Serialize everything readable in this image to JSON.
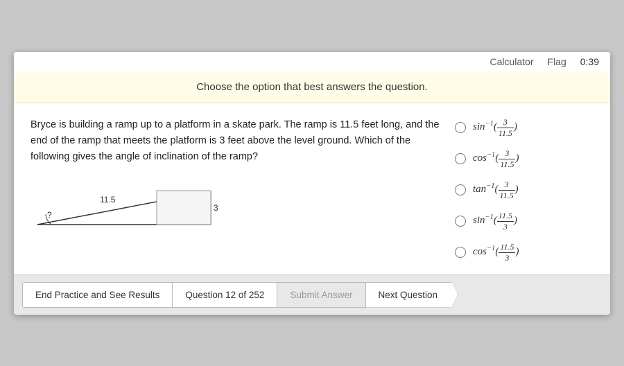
{
  "topbar": {
    "calculator_label": "Calculator",
    "flag_label": "Flag",
    "timer": "0:39"
  },
  "instruction": {
    "text": "Choose the option that best answers the question."
  },
  "question": {
    "text": "Bryce is building a ramp up to a platform in a skate park. The ramp is 11.5 feet long, and the end of the ramp that meets the platform is 3 feet above the level ground. Which of the following gives the angle of inclination of the ramp?"
  },
  "answers": [
    {
      "id": "a1",
      "label": "sin⁻¹(3/11.5)"
    },
    {
      "id": "a2",
      "label": "cos⁻¹(3/11.5)"
    },
    {
      "id": "a3",
      "label": "tan⁻¹(3/11.5)"
    },
    {
      "id": "a4",
      "label": "sin⁻¹(11.5/3)"
    },
    {
      "id": "a5",
      "label": "cos⁻¹(11.5/3)"
    }
  ],
  "diagram": {
    "hypotenuse_label": "11.5",
    "angle_label": "?",
    "opposite_label": "3"
  },
  "footer": {
    "end_practice_label": "End Practice and See Results",
    "question_label": "Question 12 of 252",
    "submit_label": "Submit Answer",
    "next_label": "Next Question"
  }
}
